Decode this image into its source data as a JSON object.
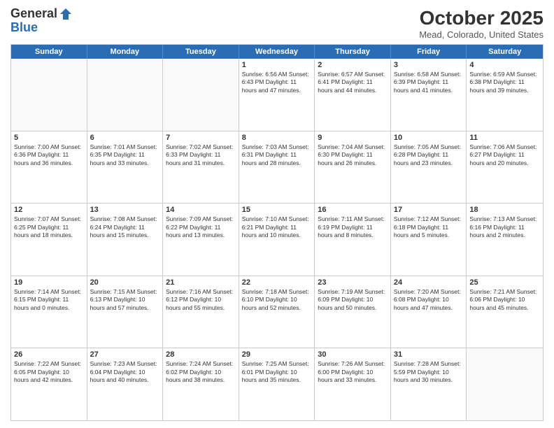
{
  "logo": {
    "general": "General",
    "blue": "Blue"
  },
  "title": "October 2025",
  "subtitle": "Mead, Colorado, United States",
  "headers": [
    "Sunday",
    "Monday",
    "Tuesday",
    "Wednesday",
    "Thursday",
    "Friday",
    "Saturday"
  ],
  "rows": [
    [
      {
        "day": "",
        "text": ""
      },
      {
        "day": "",
        "text": ""
      },
      {
        "day": "",
        "text": ""
      },
      {
        "day": "1",
        "text": "Sunrise: 6:56 AM\nSunset: 6:43 PM\nDaylight: 11 hours and 47 minutes."
      },
      {
        "day": "2",
        "text": "Sunrise: 6:57 AM\nSunset: 6:41 PM\nDaylight: 11 hours and 44 minutes."
      },
      {
        "day": "3",
        "text": "Sunrise: 6:58 AM\nSunset: 6:39 PM\nDaylight: 11 hours and 41 minutes."
      },
      {
        "day": "4",
        "text": "Sunrise: 6:59 AM\nSunset: 6:38 PM\nDaylight: 11 hours and 39 minutes."
      }
    ],
    [
      {
        "day": "5",
        "text": "Sunrise: 7:00 AM\nSunset: 6:36 PM\nDaylight: 11 hours and 36 minutes."
      },
      {
        "day": "6",
        "text": "Sunrise: 7:01 AM\nSunset: 6:35 PM\nDaylight: 11 hours and 33 minutes."
      },
      {
        "day": "7",
        "text": "Sunrise: 7:02 AM\nSunset: 6:33 PM\nDaylight: 11 hours and 31 minutes."
      },
      {
        "day": "8",
        "text": "Sunrise: 7:03 AM\nSunset: 6:31 PM\nDaylight: 11 hours and 28 minutes."
      },
      {
        "day": "9",
        "text": "Sunrise: 7:04 AM\nSunset: 6:30 PM\nDaylight: 11 hours and 26 minutes."
      },
      {
        "day": "10",
        "text": "Sunrise: 7:05 AM\nSunset: 6:28 PM\nDaylight: 11 hours and 23 minutes."
      },
      {
        "day": "11",
        "text": "Sunrise: 7:06 AM\nSunset: 6:27 PM\nDaylight: 11 hours and 20 minutes."
      }
    ],
    [
      {
        "day": "12",
        "text": "Sunrise: 7:07 AM\nSunset: 6:25 PM\nDaylight: 11 hours and 18 minutes."
      },
      {
        "day": "13",
        "text": "Sunrise: 7:08 AM\nSunset: 6:24 PM\nDaylight: 11 hours and 15 minutes."
      },
      {
        "day": "14",
        "text": "Sunrise: 7:09 AM\nSunset: 6:22 PM\nDaylight: 11 hours and 13 minutes."
      },
      {
        "day": "15",
        "text": "Sunrise: 7:10 AM\nSunset: 6:21 PM\nDaylight: 11 hours and 10 minutes."
      },
      {
        "day": "16",
        "text": "Sunrise: 7:11 AM\nSunset: 6:19 PM\nDaylight: 11 hours and 8 minutes."
      },
      {
        "day": "17",
        "text": "Sunrise: 7:12 AM\nSunset: 6:18 PM\nDaylight: 11 hours and 5 minutes."
      },
      {
        "day": "18",
        "text": "Sunrise: 7:13 AM\nSunset: 6:16 PM\nDaylight: 11 hours and 2 minutes."
      }
    ],
    [
      {
        "day": "19",
        "text": "Sunrise: 7:14 AM\nSunset: 6:15 PM\nDaylight: 11 hours and 0 minutes."
      },
      {
        "day": "20",
        "text": "Sunrise: 7:15 AM\nSunset: 6:13 PM\nDaylight: 10 hours and 57 minutes."
      },
      {
        "day": "21",
        "text": "Sunrise: 7:16 AM\nSunset: 6:12 PM\nDaylight: 10 hours and 55 minutes."
      },
      {
        "day": "22",
        "text": "Sunrise: 7:18 AM\nSunset: 6:10 PM\nDaylight: 10 hours and 52 minutes."
      },
      {
        "day": "23",
        "text": "Sunrise: 7:19 AM\nSunset: 6:09 PM\nDaylight: 10 hours and 50 minutes."
      },
      {
        "day": "24",
        "text": "Sunrise: 7:20 AM\nSunset: 6:08 PM\nDaylight: 10 hours and 47 minutes."
      },
      {
        "day": "25",
        "text": "Sunrise: 7:21 AM\nSunset: 6:06 PM\nDaylight: 10 hours and 45 minutes."
      }
    ],
    [
      {
        "day": "26",
        "text": "Sunrise: 7:22 AM\nSunset: 6:05 PM\nDaylight: 10 hours and 42 minutes."
      },
      {
        "day": "27",
        "text": "Sunrise: 7:23 AM\nSunset: 6:04 PM\nDaylight: 10 hours and 40 minutes."
      },
      {
        "day": "28",
        "text": "Sunrise: 7:24 AM\nSunset: 6:02 PM\nDaylight: 10 hours and 38 minutes."
      },
      {
        "day": "29",
        "text": "Sunrise: 7:25 AM\nSunset: 6:01 PM\nDaylight: 10 hours and 35 minutes."
      },
      {
        "day": "30",
        "text": "Sunrise: 7:26 AM\nSunset: 6:00 PM\nDaylight: 10 hours and 33 minutes."
      },
      {
        "day": "31",
        "text": "Sunrise: 7:28 AM\nSunset: 5:59 PM\nDaylight: 10 hours and 30 minutes."
      },
      {
        "day": "",
        "text": ""
      }
    ]
  ]
}
